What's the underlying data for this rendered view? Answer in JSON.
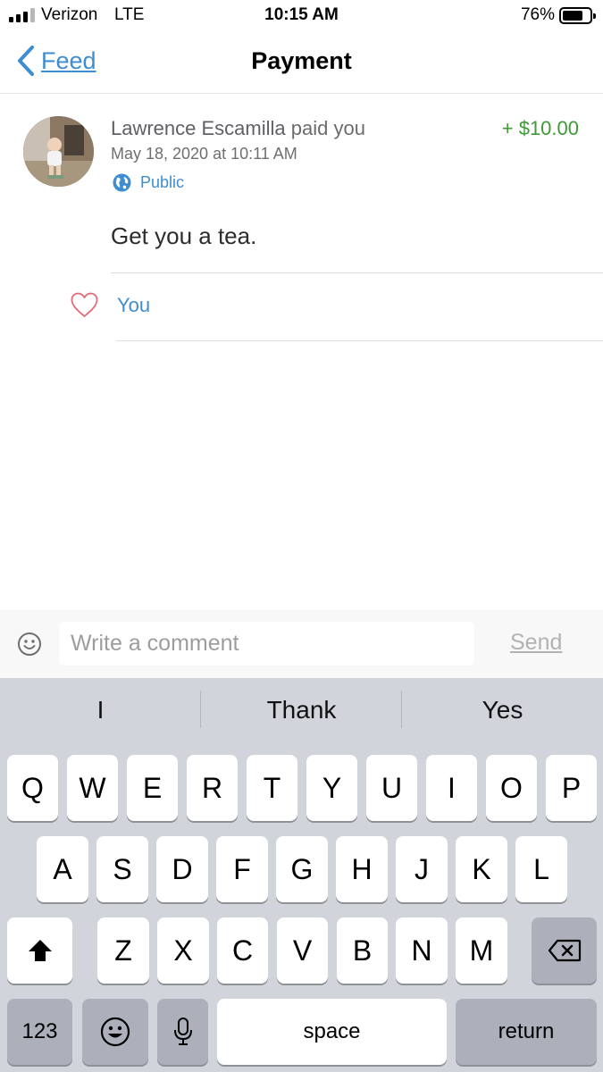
{
  "status_bar": {
    "carrier": "Verizon",
    "network": "LTE",
    "time": "10:15 AM",
    "battery_percent": "76%",
    "battery_level": 0.76
  },
  "nav": {
    "back_label": "Feed",
    "title": "Payment"
  },
  "story": {
    "actor": "Lawrence Escamilla",
    "action": " paid you",
    "amount": "+ $10.00",
    "date": "May 18, 2020 at 10:11 AM",
    "audience": "Public",
    "note": "Get you a tea.",
    "likes_label": "You"
  },
  "comment_bar": {
    "placeholder": "Write a comment",
    "send_label": "Send"
  },
  "keyboard": {
    "suggestions": [
      "I",
      "Thank",
      "Yes"
    ],
    "row1": [
      "Q",
      "W",
      "E",
      "R",
      "T",
      "Y",
      "U",
      "I",
      "O",
      "P"
    ],
    "row2": [
      "A",
      "S",
      "D",
      "F",
      "G",
      "H",
      "J",
      "K",
      "L"
    ],
    "row3": [
      "Z",
      "X",
      "C",
      "V",
      "B",
      "N",
      "M"
    ],
    "numbers_label": "123",
    "space_label": "space",
    "return_label": "return"
  },
  "colors": {
    "accent": "#3e8dd1",
    "amount_green": "#3d9a35",
    "keyboard_bg": "#d1d4da"
  },
  "icons": [
    "back-chevron-icon",
    "globe-icon",
    "heart-icon",
    "emoji-icon",
    "shift-icon",
    "backspace-icon",
    "microphone-icon"
  ]
}
